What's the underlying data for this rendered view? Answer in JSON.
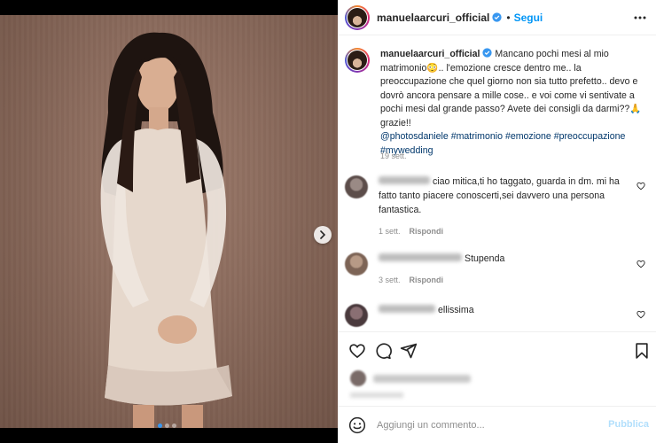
{
  "post": {
    "username": "manuelaarcuri_official",
    "follow_label": "Segui",
    "separator": "•",
    "carousel": {
      "slides": 3,
      "active_index": 0
    }
  },
  "caption": {
    "username": "manuelaarcuri_official",
    "text_part1": " Mancano pochi mesi al mio matrimonio",
    "emoji1": "😳",
    "text_part2": ".. l'emozione cresce dentro me.. la preoccupazione che quel giorno non sia tutto prefetto.. devo e dovrò ancora pensare a mille cose.. e voi come vi sentivate a pochi mesi dal grande passo? Avete dei consigli da darmi??",
    "emoji2": "🙏",
    "text_part3": " grazie!!",
    "tags": [
      "@photosdaniele",
      "#matrimonio",
      "#emozione",
      "#preoccupazione",
      "#mywedding"
    ],
    "time": "19 sett."
  },
  "comments": [
    {
      "text": "ciao mitica,ti ho taggato, guarda in dm. mi ha fatto tanto piacere conoscerti,sei davvero una persona fantastica.",
      "time": "1 sett.",
      "reply": "Rispondi"
    },
    {
      "text": "Stupenda",
      "time": "3 sett.",
      "reply": "Rispondi"
    },
    {
      "text": "ellissima",
      "time": "",
      "reply": ""
    }
  ],
  "add_comment": {
    "placeholder": "Aggiungi un commento...",
    "publish_label": "Pubblica"
  },
  "icons": {
    "header_more": "more-horizontal-icon",
    "next": "chevron-right-icon",
    "like": "heart-icon",
    "comment": "comment-bubble-icon",
    "share": "paper-plane-icon",
    "save": "bookmark-icon",
    "emoji": "smiley-icon"
  },
  "colors": {
    "accent": "#0095f6",
    "hashtag": "#00376b",
    "muted": "#8e8e8e",
    "publish_disabled": "#b2dffc"
  }
}
